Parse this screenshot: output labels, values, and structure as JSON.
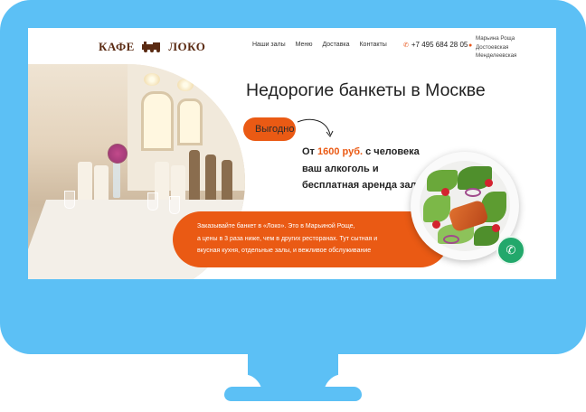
{
  "header": {
    "logo_text_left": "КАФЕ",
    "logo_text_right": "ЛОКО",
    "nav": [
      "Наши залы",
      "Меню",
      "Доставка",
      "Контакты"
    ],
    "phone": "+7 495 684 28 05",
    "address_lines": [
      "Марьина Роща",
      "Достоевская",
      "Менделеевская"
    ]
  },
  "hero": {
    "title": "Недорогие банкеты в Москве",
    "badge": "Выгодно",
    "offer_prefix": "От ",
    "offer_price": "1600 руб.",
    "offer_line1_rest": " с человека",
    "offer_line2": "ваш алкоголь и",
    "offer_line3": "бесплатная аренда зала",
    "promo_lines": [
      "Заказывайте банкет в «Локо». Это в Марьиной Роще,",
      "а цены в 3 раза ниже, чем в других ресторанах. Тут сытная и",
      "вкусная кухня, отдельные залы, и вежливое обслуживание"
    ]
  },
  "icons": {
    "phone": "phone-icon",
    "location": "location-pin-icon",
    "call_button": "phone-call-icon",
    "logo_train": "train-icon"
  },
  "colors": {
    "monitor_frame": "#5cc0f5",
    "accent": "#ea5a14",
    "call_button": "#22a86b",
    "logo": "#5a2a12"
  }
}
